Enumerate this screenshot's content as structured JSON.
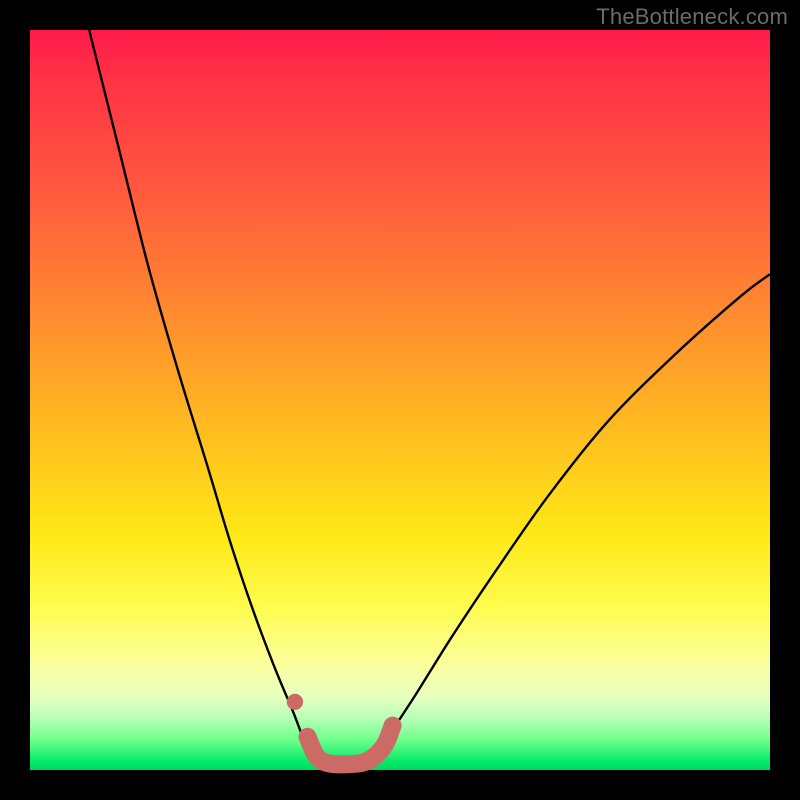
{
  "watermark": "TheBottleneck.com",
  "colors": {
    "curve_stroke": "#000000",
    "marker_stroke": "#cc6a66",
    "marker_fill": "#cc6a66"
  },
  "chart_data": {
    "type": "line",
    "title": "",
    "xlabel": "",
    "ylabel": "",
    "xlim": [
      0,
      100
    ],
    "ylim": [
      0,
      100
    ],
    "grid": false,
    "series": [
      {
        "name": "left-branch",
        "x": [
          8,
          12,
          16,
          20,
          24,
          27,
          30,
          33,
          35.5,
          37.5,
          39.5
        ],
        "y": [
          100,
          84,
          68,
          54,
          41,
          31,
          22,
          14,
          8,
          3,
          0
        ]
      },
      {
        "name": "right-branch",
        "x": [
          45,
          48,
          52,
          57,
          63,
          70,
          78,
          87,
          96,
          100
        ],
        "y": [
          0,
          4,
          10,
          18,
          27,
          37,
          47,
          56,
          64,
          67
        ]
      },
      {
        "name": "valley-marker-curve",
        "x": [
          37.5,
          38.5,
          39.5,
          41,
          43,
          45,
          46.5,
          48,
          49
        ],
        "y": [
          4.5,
          2.2,
          1.2,
          0.8,
          0.8,
          1.0,
          1.8,
          3.5,
          6.0
        ]
      }
    ],
    "markers": [
      {
        "name": "left-dot",
        "x": 35.8,
        "y": 9.2,
        "r": 1.1
      }
    ]
  }
}
